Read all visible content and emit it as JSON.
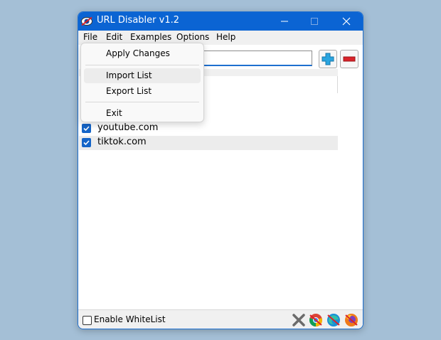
{
  "window": {
    "title": "URL Disabler v1.2"
  },
  "menubar": {
    "items": [
      "File",
      "Edit",
      "Examples",
      "Options",
      "Help"
    ]
  },
  "file_menu": {
    "items": [
      {
        "label": "Apply Changes"
      },
      {
        "label": "Import List",
        "hovered": true
      },
      {
        "label": "Export List"
      },
      {
        "label": "Exit"
      }
    ]
  },
  "url_input": {
    "value": ""
  },
  "list": {
    "items": [
      {
        "label": "youtube.com",
        "checked": true
      },
      {
        "label": "tiktok.com",
        "checked": true
      }
    ]
  },
  "statusbar": {
    "whitelist_label": "Enable WhiteList",
    "whitelist_checked": false,
    "icons": [
      "clear-x-icon",
      "chrome-disabled-icon",
      "edge-disabled-icon",
      "firefox-disabled-icon"
    ]
  },
  "colors": {
    "accent": "#0b64d3",
    "add": "#2aa5e0",
    "remove": "#d9232a",
    "desktop": "#a4bfd6"
  }
}
